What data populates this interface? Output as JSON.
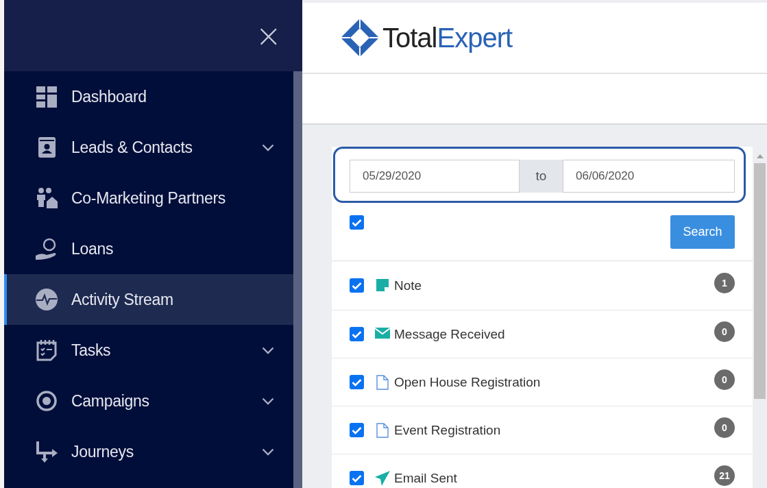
{
  "sidebar": {
    "close_label": "×",
    "items": [
      {
        "label": "Dashboard",
        "selected": false,
        "kind": "link"
      },
      {
        "label": "Leads & Contacts",
        "selected": false,
        "kind": "group"
      },
      {
        "label": "Co-Marketing Partners",
        "selected": false,
        "kind": "link"
      },
      {
        "label": "Loans",
        "selected": false,
        "kind": "link"
      },
      {
        "label": "Activity Stream",
        "selected": true,
        "kind": "link"
      },
      {
        "label": "Tasks",
        "selected": false,
        "kind": "group"
      },
      {
        "label": "Campaigns",
        "selected": false,
        "kind": "group"
      },
      {
        "label": "Journeys",
        "selected": false,
        "kind": "group"
      }
    ]
  },
  "header": {
    "logo_parts": [
      "Total",
      "Expert"
    ]
  },
  "filter": {
    "date_from": "05/29/2020",
    "separator": "to",
    "date_to": "06/06/2020",
    "select_all_checked": true,
    "search_button": "Search",
    "activities": [
      {
        "label": "Note",
        "checked": true,
        "count": "1"
      },
      {
        "label": "Message Received",
        "checked": true,
        "count": "0"
      },
      {
        "label": "Open House Registration",
        "checked": true,
        "count": "0"
      },
      {
        "label": "Event Registration",
        "checked": true,
        "count": "0"
      },
      {
        "label": "Email Sent",
        "checked": true,
        "count": "21"
      }
    ]
  }
}
